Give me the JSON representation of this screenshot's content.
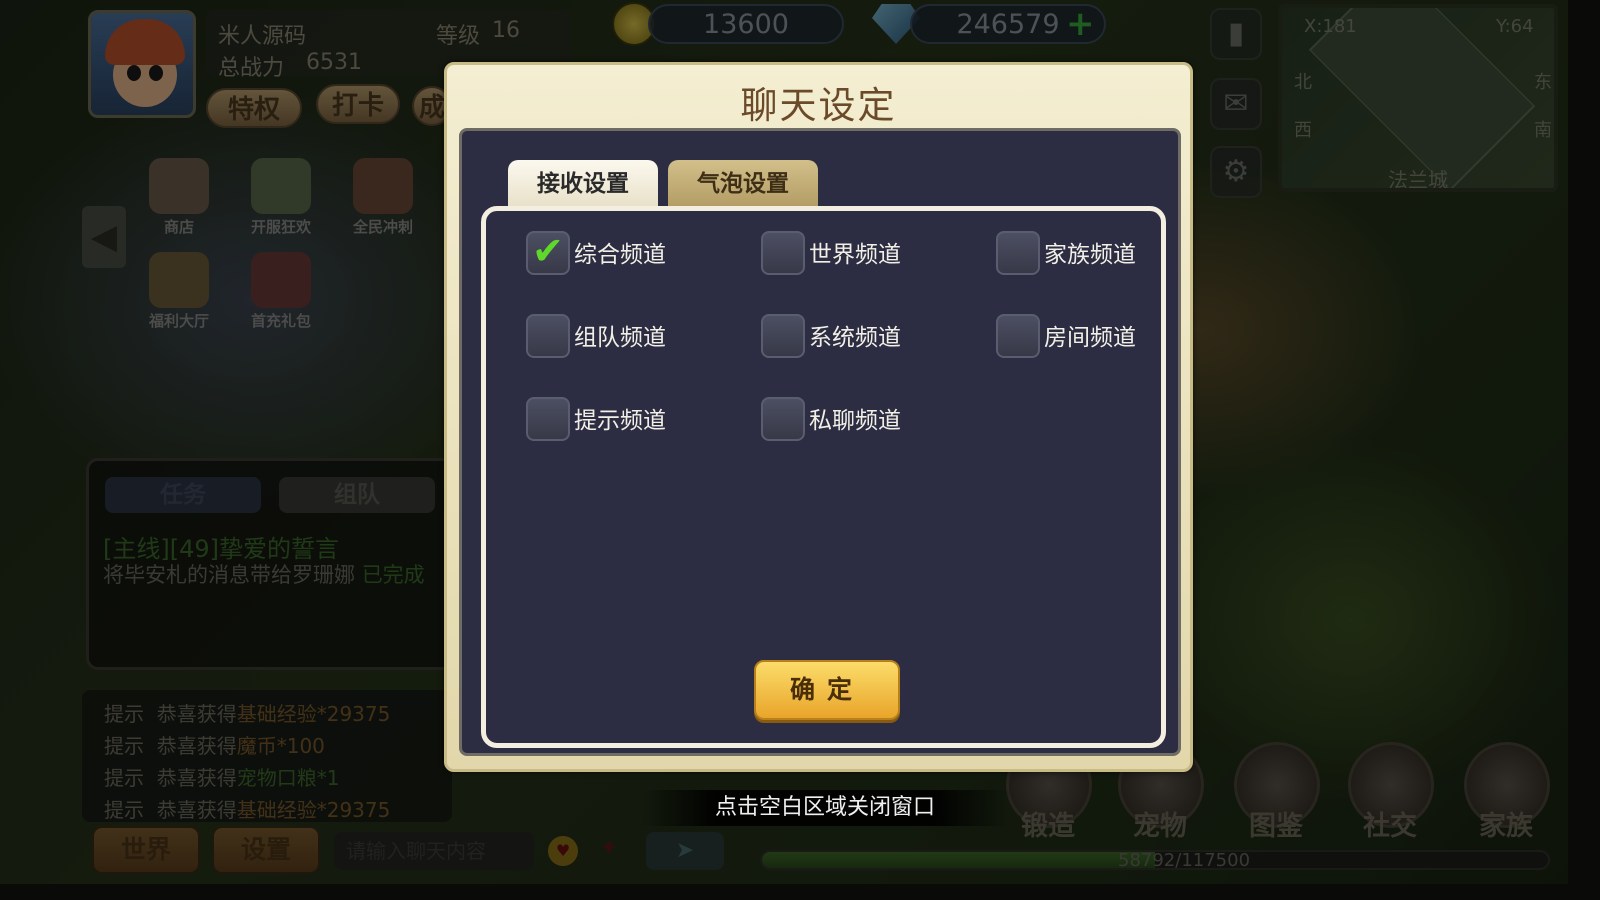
{
  "player": {
    "name": "米人源码",
    "level_label": "等级",
    "level": "16",
    "power_label": "总战力",
    "power": "6531"
  },
  "top_buttons": [
    "特权",
    "打卡",
    "成"
  ],
  "currency": {
    "gold": "13600",
    "gems": "246579"
  },
  "minimap": {
    "x": "X:181",
    "y": "Y:64",
    "north": "北",
    "east": "东",
    "west": "西",
    "south": "南",
    "city": "法兰城"
  },
  "left_menu": [
    {
      "label": "商店",
      "icon": "shop-icon"
    },
    {
      "label": "开服狂欢",
      "icon": "carnival-icon"
    },
    {
      "label": "全民冲刺",
      "icon": "rush-icon"
    },
    {
      "label": "福利大厅",
      "icon": "welfare-icon"
    },
    {
      "label": "首充礼包",
      "icon": "gift-icon"
    }
  ],
  "quest": {
    "tabs": [
      "任务",
      "组队"
    ],
    "title": "[主线][49]挚爱的誓言",
    "desc": "将毕安札的消息带给罗珊娜",
    "status": "已完成"
  },
  "chat_log": [
    {
      "tag": "提示",
      "text": "恭喜获得",
      "item": "基础经验*29375",
      "color": "orange"
    },
    {
      "tag": "提示",
      "text": "恭喜获得",
      "item": "魔币*100",
      "color": "orange"
    },
    {
      "tag": "提示",
      "text": "恭喜获得",
      "item": "宠物口粮*1",
      "color": "green"
    },
    {
      "tag": "提示",
      "text": "恭喜获得",
      "item": "基础经验*29375",
      "color": "orange"
    }
  ],
  "chat_bar": {
    "world_label": "世界",
    "settings_label": "设置",
    "input_placeholder": "请输入聊天内容"
  },
  "bottom_menu": [
    {
      "label": "锻造",
      "icon": "forge-icon"
    },
    {
      "label": "宠物",
      "icon": "pet-icon"
    },
    {
      "label": "图鉴",
      "icon": "codex-icon"
    },
    {
      "label": "社交",
      "icon": "social-icon"
    },
    {
      "label": "家族",
      "icon": "family-icon"
    }
  ],
  "xp": {
    "current": 58792,
    "max": 117500,
    "text": "58792/117500"
  },
  "hint": "点击空白区域关闭窗口",
  "dialog": {
    "title": "聊天设定",
    "tabs": [
      "接收设置",
      "气泡设置"
    ],
    "options": [
      {
        "label": "综合频道",
        "checked": true
      },
      {
        "label": "世界频道",
        "checked": false
      },
      {
        "label": "家族频道",
        "checked": false
      },
      {
        "label": "组队频道",
        "checked": false
      },
      {
        "label": "系统频道",
        "checked": false
      },
      {
        "label": "房间频道",
        "checked": false
      },
      {
        "label": "提示频道",
        "checked": false
      },
      {
        "label": "私聊频道",
        "checked": false
      }
    ],
    "confirm_label": "确定"
  },
  "colors": {
    "dialog_bg": "#2c2d43",
    "accent_gold": "#f2c24a",
    "check_green": "#5ed82a"
  }
}
